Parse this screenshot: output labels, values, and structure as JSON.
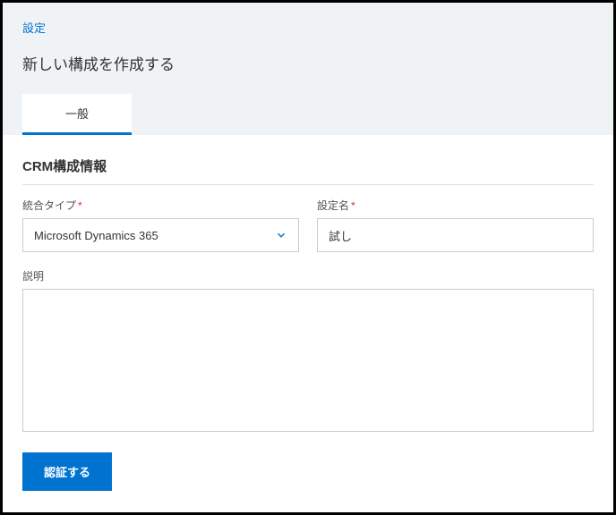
{
  "breadcrumb": "設定",
  "page_title": "新しい構成を作成する",
  "tabs": {
    "general": "一般"
  },
  "section": {
    "title": "CRM構成情報"
  },
  "form": {
    "integration_type": {
      "label": "統合タイプ",
      "value": "Microsoft Dynamics 365"
    },
    "config_name": {
      "label": "設定名",
      "value": "試し"
    },
    "description": {
      "label": "説明",
      "value": ""
    }
  },
  "buttons": {
    "authenticate": "認証する"
  },
  "required_mark": "*"
}
